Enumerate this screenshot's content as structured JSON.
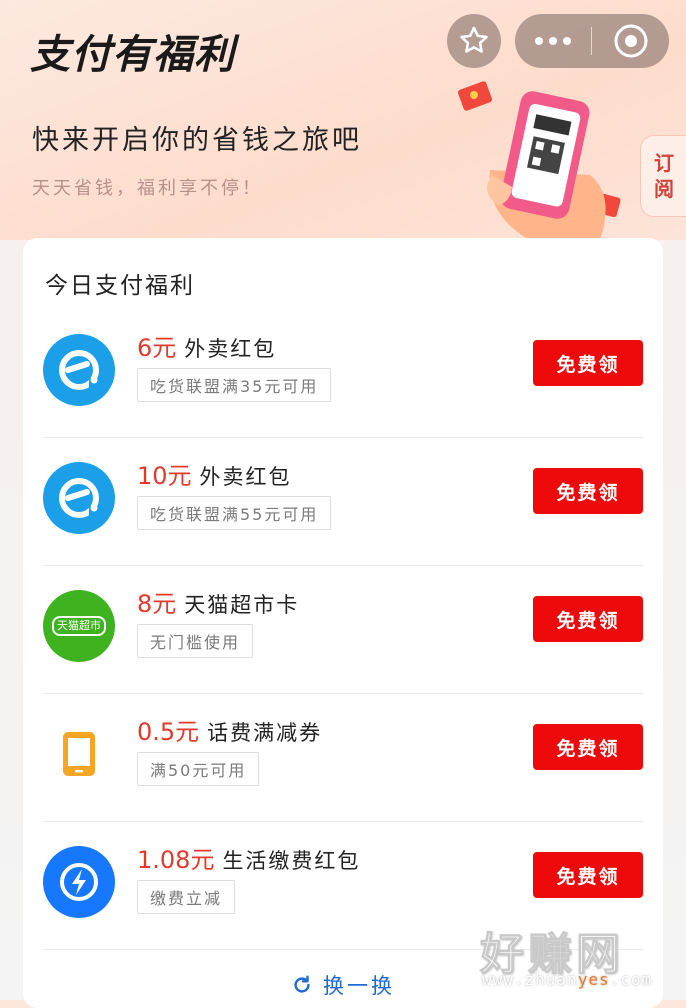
{
  "header": {
    "title": "支付有福利",
    "subtitle": "快来开启你的省钱之旅吧",
    "tagline": "天天省钱，福利享不停！",
    "subscribe_label_1": "订",
    "subscribe_label_2": "阅"
  },
  "card": {
    "title": "今日支付福利",
    "items": [
      {
        "amount": "6元",
        "title": "外卖红包",
        "condition": "吃货联盟满35元可用",
        "button": "免费领",
        "icon": "eleme-icon"
      },
      {
        "amount": "10元",
        "title": "外卖红包",
        "condition": "吃货联盟满55元可用",
        "button": "免费领",
        "icon": "eleme-icon"
      },
      {
        "amount": "8元",
        "title": "天猫超市卡",
        "condition": "无门槛使用",
        "button": "免费领",
        "icon": "tmall-supermarket-icon",
        "icon_text": "天猫超市"
      },
      {
        "amount": "0.5元",
        "title": "话费满减券",
        "condition": "满50元可用",
        "button": "免费领",
        "icon": "phone-icon"
      },
      {
        "amount": "1.08元",
        "title": "生活缴费红包",
        "condition": "缴费立减",
        "button": "免费领",
        "icon": "lightning-icon"
      }
    ],
    "refresh_label": "换一换"
  },
  "watermark": {
    "big": "好赚网",
    "small_1": "www.zhuan",
    "small_2": "yes",
    "small_3": ".com"
  },
  "colors": {
    "accent_red": "#e03a2e",
    "button_red": "#ee0a0a",
    "link_blue": "#1e6bd6",
    "eleme_blue": "#1a9fe8",
    "tmall_green": "#3fb31f",
    "phone_orange": "#f5a623"
  }
}
